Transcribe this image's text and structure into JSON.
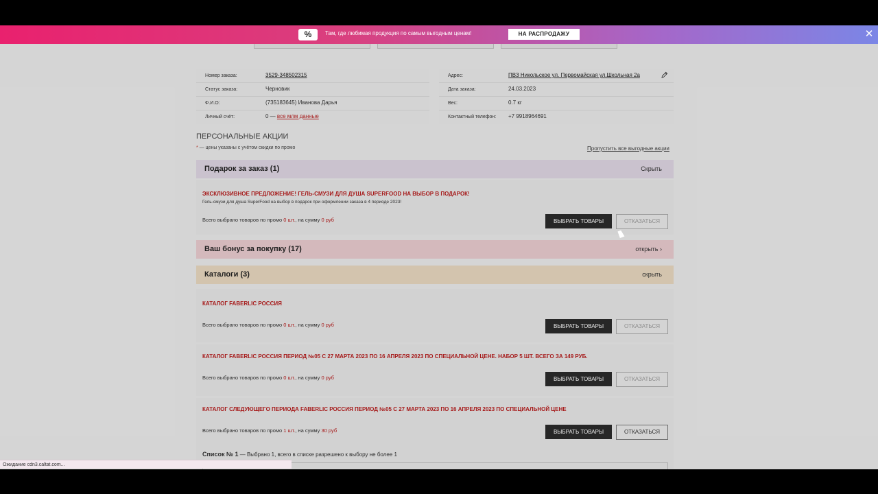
{
  "promo": {
    "icon": "%",
    "text": "Там, где любимая продукция по самым выгодным ценам!",
    "button": "НА РАСПРОДАЖУ",
    "close": "✕"
  },
  "order": {
    "number_label": "Номер заказа:",
    "number_value": "3529-348502315",
    "status_label": "Статус заказа:",
    "status_value": "Черновик",
    "name_label": "Ф.И.О:",
    "name_value": "(735183645) Иванова Дарья",
    "account_label": "Личный счёт:",
    "account_value": "0 — ",
    "account_link": "все млм данные",
    "address_label": "Адрес:",
    "address_value": "ПВЗ Никольское ул. Первомайская ул.Школьная 2а",
    "date_label": "Дата заказа:",
    "date_value": "24.03.2023",
    "weight_label": "Вес:",
    "weight_value": "0.7 кг",
    "phone_label": "Контактный телефон:",
    "phone_value": "+7 9918964691"
  },
  "promos_section": {
    "title": "ПЕРСОНАЛЬНЫЕ АКЦИИ",
    "note_star": "*",
    "note": " — цены указаны с учётом скидки по промо",
    "skip_link": "Пропустить все выгодные акции"
  },
  "gift": {
    "header": "Подарок за заказ (1)",
    "action": "Скрыть",
    "offer_title": "ЭКСКЛЮЗИВНОЕ ПРЕДЛОЖЕНИЕ! ГЕЛЬ-СМУЗИ ДЛЯ ДУША SUPERFOOD НА ВЫБОР В ПОДАРОК!",
    "offer_sub": "Гель-смузи для душа SuperFood на выбор в подарок при оформлении заказа в 4 периоде 2023!",
    "summary_prefix": "Всего выбрано товаров по промо ",
    "qty": "0 шт.",
    "summary_mid": ", на сумму ",
    "sum": "0 руб",
    "choose": "ВЫБРАТЬ ТОВАРЫ",
    "refuse": "ОТКАЗАТЬСЯ"
  },
  "bonus": {
    "header": "Ваш бонус за покупку (17)",
    "action": "открыть ›"
  },
  "catalogs": {
    "header": "Каталоги (3)",
    "action": "скрыть",
    "items": [
      {
        "title": "КАТАЛОГ FABERLIC РОССИЯ",
        "summary_prefix": "Всего выбрано товаров по промо ",
        "qty": "0 шт.",
        "summary_mid": ", на сумму ",
        "sum": "0 руб",
        "choose": "ВЫБРАТЬ ТОВАРЫ",
        "refuse": "ОТКАЗАТЬСЯ"
      },
      {
        "title": "КАТАЛОГ FABERLIC РОССИЯ ПЕРИОД №05 С 27 МАРТА 2023 ПО 16 АПРЕЛЯ 2023 ПО СПЕЦИАЛЬНОЙ ЦЕНЕ. НАБОР 5 ШТ. ВСЕГО ЗА 149 РУБ.",
        "summary_prefix": "Всего выбрано товаров по промо ",
        "qty": "0 шт.",
        "summary_mid": ", на сумму ",
        "sum": "0 руб",
        "choose": "ВЫБРАТЬ ТОВАРЫ",
        "refuse": "ОТКАЗАТЬСЯ"
      },
      {
        "title": "КАТАЛОГ СЛЕДУЮЩЕГО ПЕРИОДА FABERLIC РОССИЯ ПЕРИОД №05 С 27 МАРТА 2023 ПО 16 АПРЕЛЯ 2023 ПО СПЕЦИАЛЬНОЙ ЦЕНЕ",
        "summary_prefix": "Всего выбрано товаров по промо ",
        "qty": "1 шт.",
        "summary_mid": ", на сумму ",
        "sum": "30 руб",
        "choose": "ВЫБРАТЬ ТОВАРЫ",
        "refuse": "ОТКАЗАТЬСЯ"
      }
    ],
    "list_label": "Список № 1",
    "list_text": " — Выбрано 1, всего в списке разрешено к выбору не более 1"
  },
  "status_bar": "Ожидание cdn3.caltat.com...",
  "colors": {
    "accent_red": "#b51d1d",
    "gift_header": "#dcd3e0",
    "bonus_header": "#e6c9cc",
    "catalog_header": "#e5d5bd",
    "dark_button": "#2b2b2b"
  },
  "icons": [
    "percent-icon",
    "close-icon",
    "edit-pencil-icon"
  ]
}
